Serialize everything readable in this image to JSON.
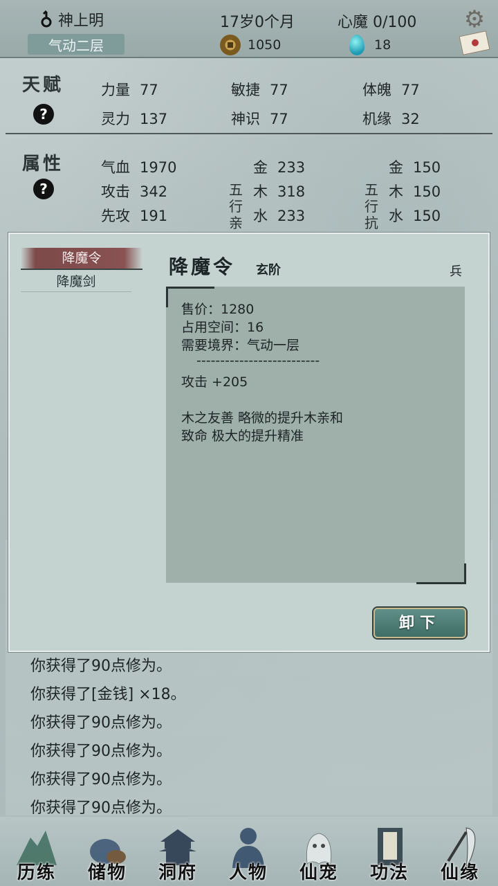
{
  "header": {
    "player_name": "神上明",
    "realm": "气动二层",
    "age": "17岁0个月",
    "heart_demon": "心魔 0/100",
    "gold": "1050",
    "gems": "18"
  },
  "talent": {
    "title": "天赋",
    "help": "?",
    "stats": [
      {
        "label": "力量",
        "value": "77"
      },
      {
        "label": "敏捷",
        "value": "77"
      },
      {
        "label": "体魄",
        "value": "77"
      },
      {
        "label": "灵力",
        "value": "137"
      },
      {
        "label": "神识",
        "value": "77"
      },
      {
        "label": "机缘",
        "value": "32"
      }
    ]
  },
  "attributes": {
    "title": "属性",
    "help": "?",
    "stats": [
      {
        "label": "气血",
        "value": "1970"
      },
      {
        "label": "攻击",
        "value": "342"
      },
      {
        "label": "先攻",
        "value": "191"
      }
    ],
    "affinity_label": "五行亲",
    "affinity": [
      {
        "label": "金",
        "value": "233"
      },
      {
        "label": "木",
        "value": "318"
      },
      {
        "label": "水",
        "value": "233"
      }
    ],
    "resist_label": "五行抗",
    "resist": [
      {
        "label": "金",
        "value": "150"
      },
      {
        "label": "木",
        "value": "150"
      },
      {
        "label": "水",
        "value": "150"
      }
    ]
  },
  "log": [
    "你获得了90点修为。",
    "你获得了[金钱] ×18。",
    "你获得了90点修为。",
    "你获得了90点修为。",
    "你获得了90点修为。",
    "你获得了90点修为。"
  ],
  "modal": {
    "list": [
      "降魔令",
      "降魔剑"
    ],
    "item_name": "降魔令",
    "item_tier": "玄阶",
    "item_type": "兵",
    "price": "售价：1280",
    "space": "占用空间：16",
    "realm_req": "需要境界：气动一层",
    "separator": "--------------------------",
    "attack": "攻击 +205",
    "effect1": "木之友善 略微的提升木亲和",
    "effect2": "致命 极大的提升精准",
    "unequip": "卸下"
  },
  "nav": [
    "历练",
    "储物",
    "洞府",
    "人物",
    "仙宠",
    "功法",
    "仙缘"
  ],
  "colors": {
    "accent_teal": "#3f6e67",
    "selected_red": "#8a5252",
    "background": "#b9c6c6"
  }
}
